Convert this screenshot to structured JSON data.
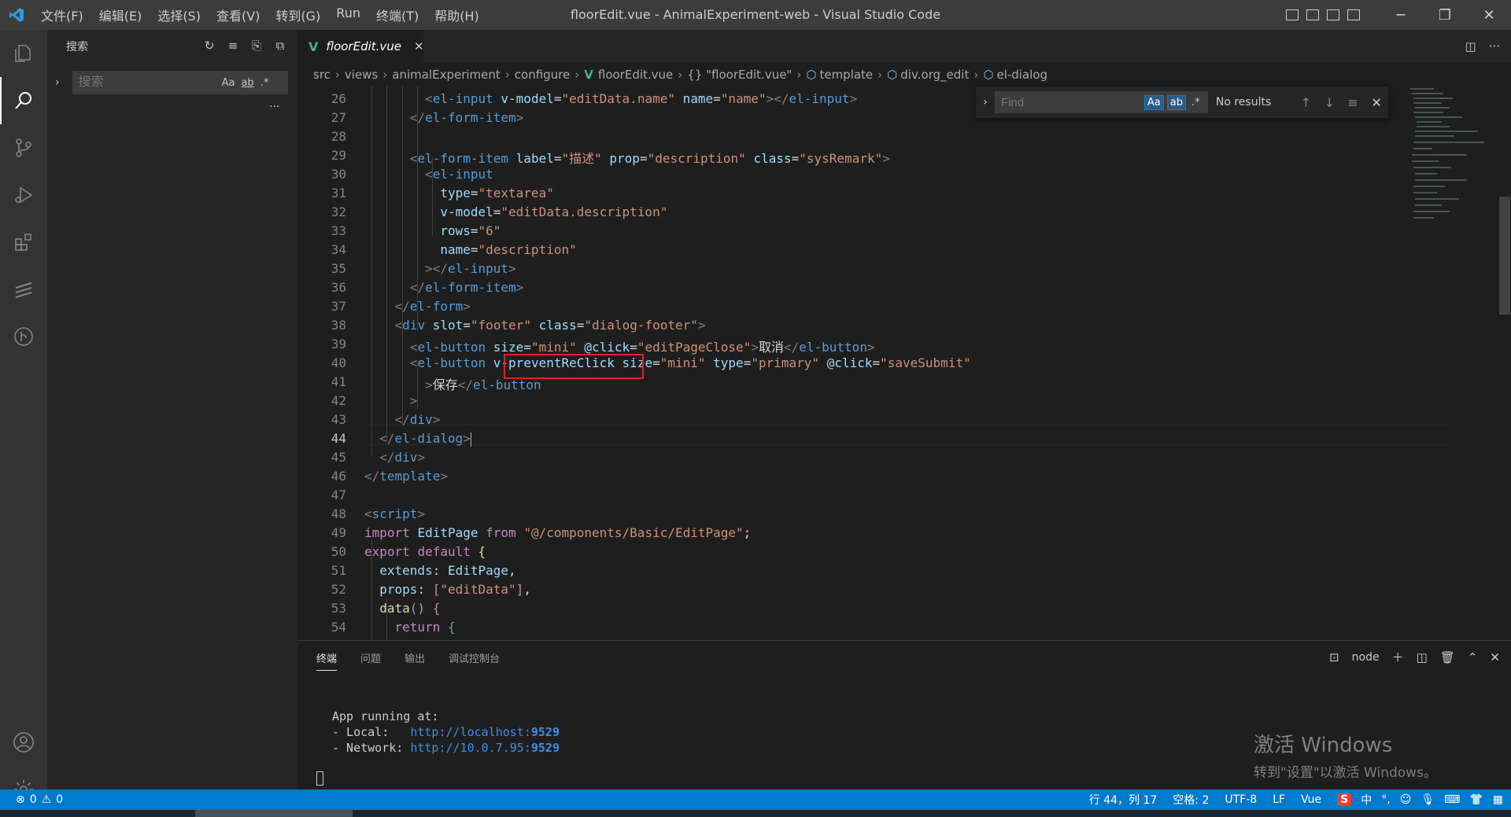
{
  "window": {
    "title": "floorEdit.vue - AnimalExperiment-web - Visual Studio Code",
    "menu": [
      "文件(F)",
      "编辑(E)",
      "选择(S)",
      "查看(V)",
      "转到(G)",
      "Run",
      "终端(T)",
      "帮助(H)"
    ],
    "controls": {
      "minimize": "─",
      "restore": "❐",
      "close": "✕"
    }
  },
  "sidebar": {
    "title": "搜索",
    "search_placeholder": "搜索",
    "opts": {
      "case": "Aa",
      "word": "ab",
      "regex": ".*"
    },
    "more": "..."
  },
  "tab": {
    "label": "floorEdit.vue",
    "icon": "V",
    "close": "✕"
  },
  "breadcrumb": {
    "items": [
      "src",
      "views",
      "animalExperiment",
      "configure",
      "floorEdit.vue",
      "{} \"floorEdit.vue\"",
      "template",
      "div.org_edit",
      "el-dialog"
    ]
  },
  "find": {
    "placeholder": "Find",
    "case": "Aa",
    "word": "ab",
    "regex": ".*",
    "results": "No results"
  },
  "editor": {
    "line_numbers": [
      "26",
      "27",
      "28",
      "29",
      "30",
      "31",
      "32",
      "33",
      "34",
      "35",
      "36",
      "37",
      "38",
      "39",
      "40",
      "41",
      "42",
      "43",
      "44",
      "45",
      "46",
      "47",
      "48",
      "49",
      "50",
      "51",
      "52",
      "53",
      "54"
    ],
    "current_line": "44"
  },
  "panel": {
    "tabs": [
      "终端",
      "问题",
      "输出",
      "调试控制台"
    ],
    "shell": "node",
    "terminal": {
      "line1": "App running at:",
      "local_label": "- Local:   ",
      "local_url": "http://localhost:",
      "local_port": "9529",
      "network_label": "- Network: ",
      "network_url": "http://10.0.7.95:",
      "network_port": "9529"
    },
    "watermark": {
      "title": "激活 Windows",
      "subtitle": "转到\"设置\"以激活 Windows。"
    }
  },
  "status": {
    "errors": "0",
    "warnings": "0",
    "position": "行 44，列 17",
    "spaces": "空格: 2",
    "encoding": "UTF-8",
    "eol": "LF",
    "language": "Vue",
    "ime": "中"
  },
  "colors": {
    "accent": "#007acc",
    "highlight_box": "#e02020"
  }
}
